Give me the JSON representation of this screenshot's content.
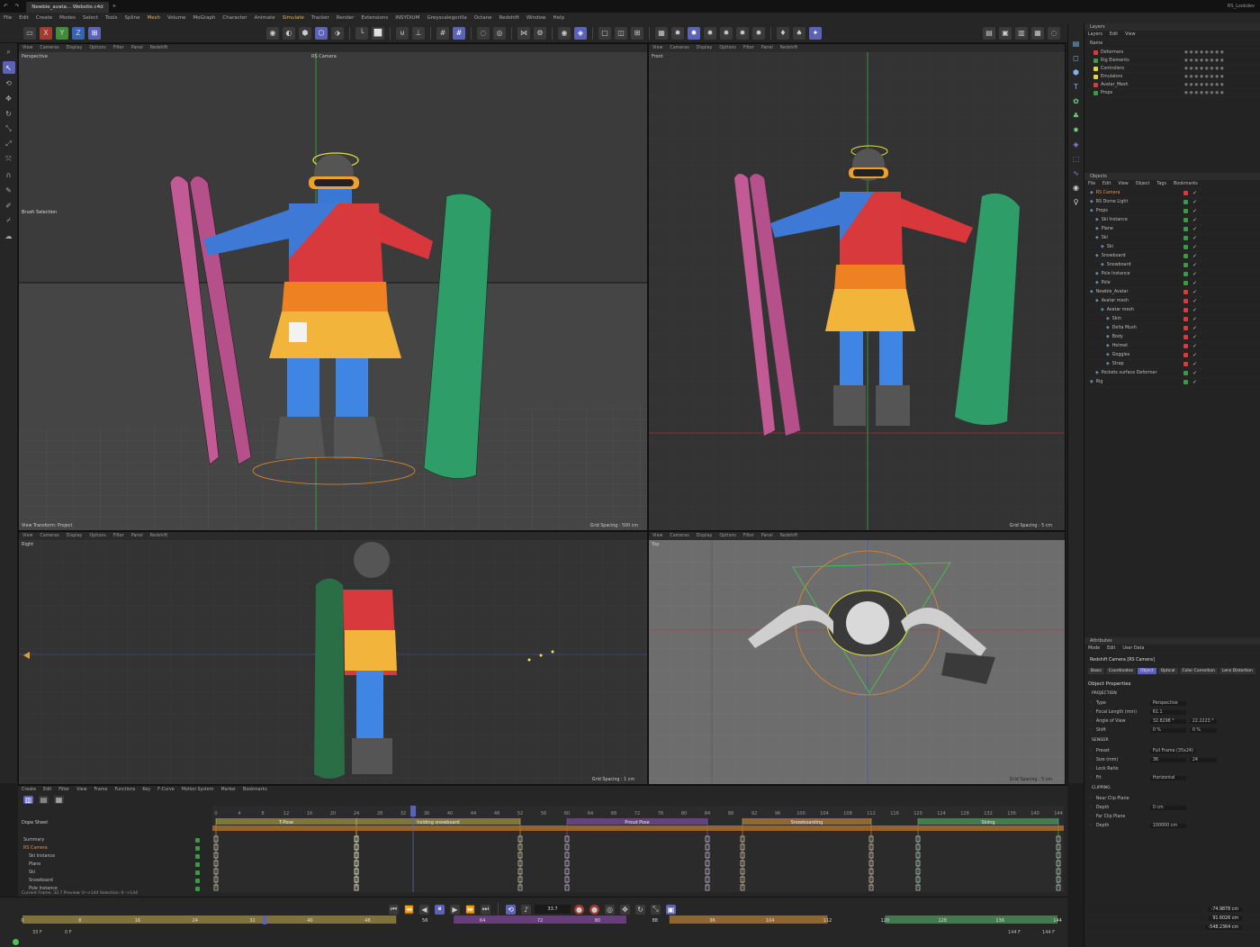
{
  "titlebar": {
    "tab": "Newbie_avata... Website.c4d",
    "right": "RS_Lookdev"
  },
  "menu": [
    "File",
    "Edit",
    "Create",
    "Modes",
    "Select",
    "Tools",
    "Spline",
    "Mesh",
    "Volume",
    "MoGraph",
    "Character",
    "Animate",
    "Simulate",
    "Tracker",
    "Render",
    "Extensions",
    "INSYDIUM",
    "Greyscalegorilla",
    "Octane",
    "Redshift",
    "Window",
    "Help"
  ],
  "toolbar": {
    "axes": [
      "X",
      "Y",
      "Z"
    ]
  },
  "viewport_menu": [
    "View",
    "Cameras",
    "Display",
    "Options",
    "Filter",
    "Panel",
    "Redshift"
  ],
  "viewports": {
    "persp": {
      "label": "Perspective",
      "camera": "RS Camera",
      "hud": "Brush Selection",
      "foot_left": "View Transform: Project",
      "foot_right": "Grid Spacing : 500 cm"
    },
    "front": {
      "label": "Front",
      "foot_right": "Grid Spacing : 5 cm"
    },
    "right": {
      "label": "Right",
      "foot_right": "Grid Spacing : 1 cm"
    },
    "top": {
      "label": "Top",
      "foot_right": "Grid Spacing : 5 cm"
    }
  },
  "layers": {
    "title": "Layers",
    "menu": [
      "Layers",
      "Edit",
      "View"
    ],
    "col": "Name",
    "items": [
      {
        "name": "Deformers",
        "color": "#d93b3b"
      },
      {
        "name": "Rig Elements",
        "color": "#3a9b44"
      },
      {
        "name": "Controllers",
        "color": "#e6d435"
      },
      {
        "name": "Emulators",
        "color": "#e6d435"
      },
      {
        "name": "Avatar_Mesh",
        "color": "#d93b3b"
      },
      {
        "name": "Props",
        "color": "#3a9b44"
      }
    ]
  },
  "objects": {
    "title": "Objects",
    "menu": [
      "File",
      "Edit",
      "View",
      "Object",
      "Tags",
      "Bookmarks"
    ],
    "items": [
      "RS Camera",
      "RS Dome Light",
      "Props",
      "Ski Instance",
      "Plane",
      "Ski",
      "Ski",
      "Snowboard",
      "Snowboard",
      "Pole Instance",
      "Pole",
      "Newbie_Avatar",
      "Avatar mesh",
      "Avatar mesh",
      "Skin",
      "Delta Mush",
      "Body",
      "Helmet",
      "Goggles",
      "Strap",
      "Pockets surface Deformer",
      "Rig"
    ]
  },
  "attributes": {
    "title": "Attributes",
    "menu": [
      "Mode",
      "Edit",
      "User Data"
    ],
    "object": "Redshift Camera [RS Camera]",
    "tabs": [
      "Basic",
      "Coordinates",
      "Object",
      "Optical",
      "Color Correction",
      "Lens Distortion"
    ],
    "section": "Object Properties",
    "projection_label": "PROJECTION",
    "fields": [
      {
        "label": "Type",
        "value": "Perspective"
      },
      {
        "label": "Focal Length (mm)",
        "value": "61.1"
      },
      {
        "label": "Angle of View",
        "value": "32.8298 °",
        "value2": "22.2223 °"
      },
      {
        "label": "Shift",
        "value": "0 %",
        "value2": "0 %"
      }
    ],
    "sensor_label": "SENSOR",
    "sensor": [
      {
        "label": "Preset",
        "value": "Full Frame (35x24)"
      },
      {
        "label": "Size (mm)",
        "value": "36",
        "value2": "24"
      },
      {
        "label": "Lock Ratio",
        "value": ""
      },
      {
        "label": "Fit",
        "value": "Horizontal"
      }
    ],
    "clipping_label": "CLIPPING",
    "clipping": [
      {
        "label": "Near Clip Plane",
        "value": ""
      },
      {
        "label": "Depth",
        "value": "0 cm"
      },
      {
        "label": "Far Clip Plane",
        "value": ""
      },
      {
        "label": "Depth",
        "value": "100000 cm"
      }
    ],
    "coords": [
      "-74.9878 cm",
      "91.6026 cm",
      "-548.2364 cm"
    ]
  },
  "timeline": {
    "menu": [
      "Create",
      "Edit",
      "Filter",
      "View",
      "Frame",
      "Functions",
      "Key",
      "F-Curve",
      "Motion System",
      "Marker",
      "Bookmarks"
    ],
    "title": "Dope Sheet",
    "tracks": [
      "Summary",
      "RS Camera",
      "Ski Instance",
      "Plane",
      "Ski",
      "Snowboard",
      "Pole Instance"
    ],
    "ruler": [
      "0",
      "4",
      "8",
      "12",
      "16",
      "20",
      "24",
      "28",
      "32",
      "36",
      "40",
      "44",
      "48",
      "52",
      "56",
      "60",
      "64",
      "68",
      "72",
      "76",
      "80",
      "84",
      "88",
      "92",
      "96",
      "100",
      "104",
      "108",
      "112",
      "116",
      "120",
      "124",
      "128",
      "132",
      "136",
      "140",
      "144"
    ],
    "markers": [
      {
        "name": "T-Pose",
        "start": 0,
        "end": 24,
        "color": "#c8b24a"
      },
      {
        "name": "holding snowboard",
        "start": 24,
        "end": 52,
        "color": "#c8b24a"
      },
      {
        "name": "Proud Pose",
        "start": 60,
        "end": 84,
        "color": "#9b52c6"
      },
      {
        "name": "Snowboarding",
        "start": 90,
        "end": 112,
        "color": "#e39a3a"
      },
      {
        "name": "Skiing",
        "start": 120,
        "end": 144,
        "color": "#5cbb6f"
      }
    ],
    "status": "Current Frame: 33.7   Preview: 0-->144   Selection: 0-->144"
  },
  "transport": {
    "frame": "33 F",
    "start": "0 F",
    "end": "144 F",
    "end2": "144 F",
    "current": "33.7"
  }
}
